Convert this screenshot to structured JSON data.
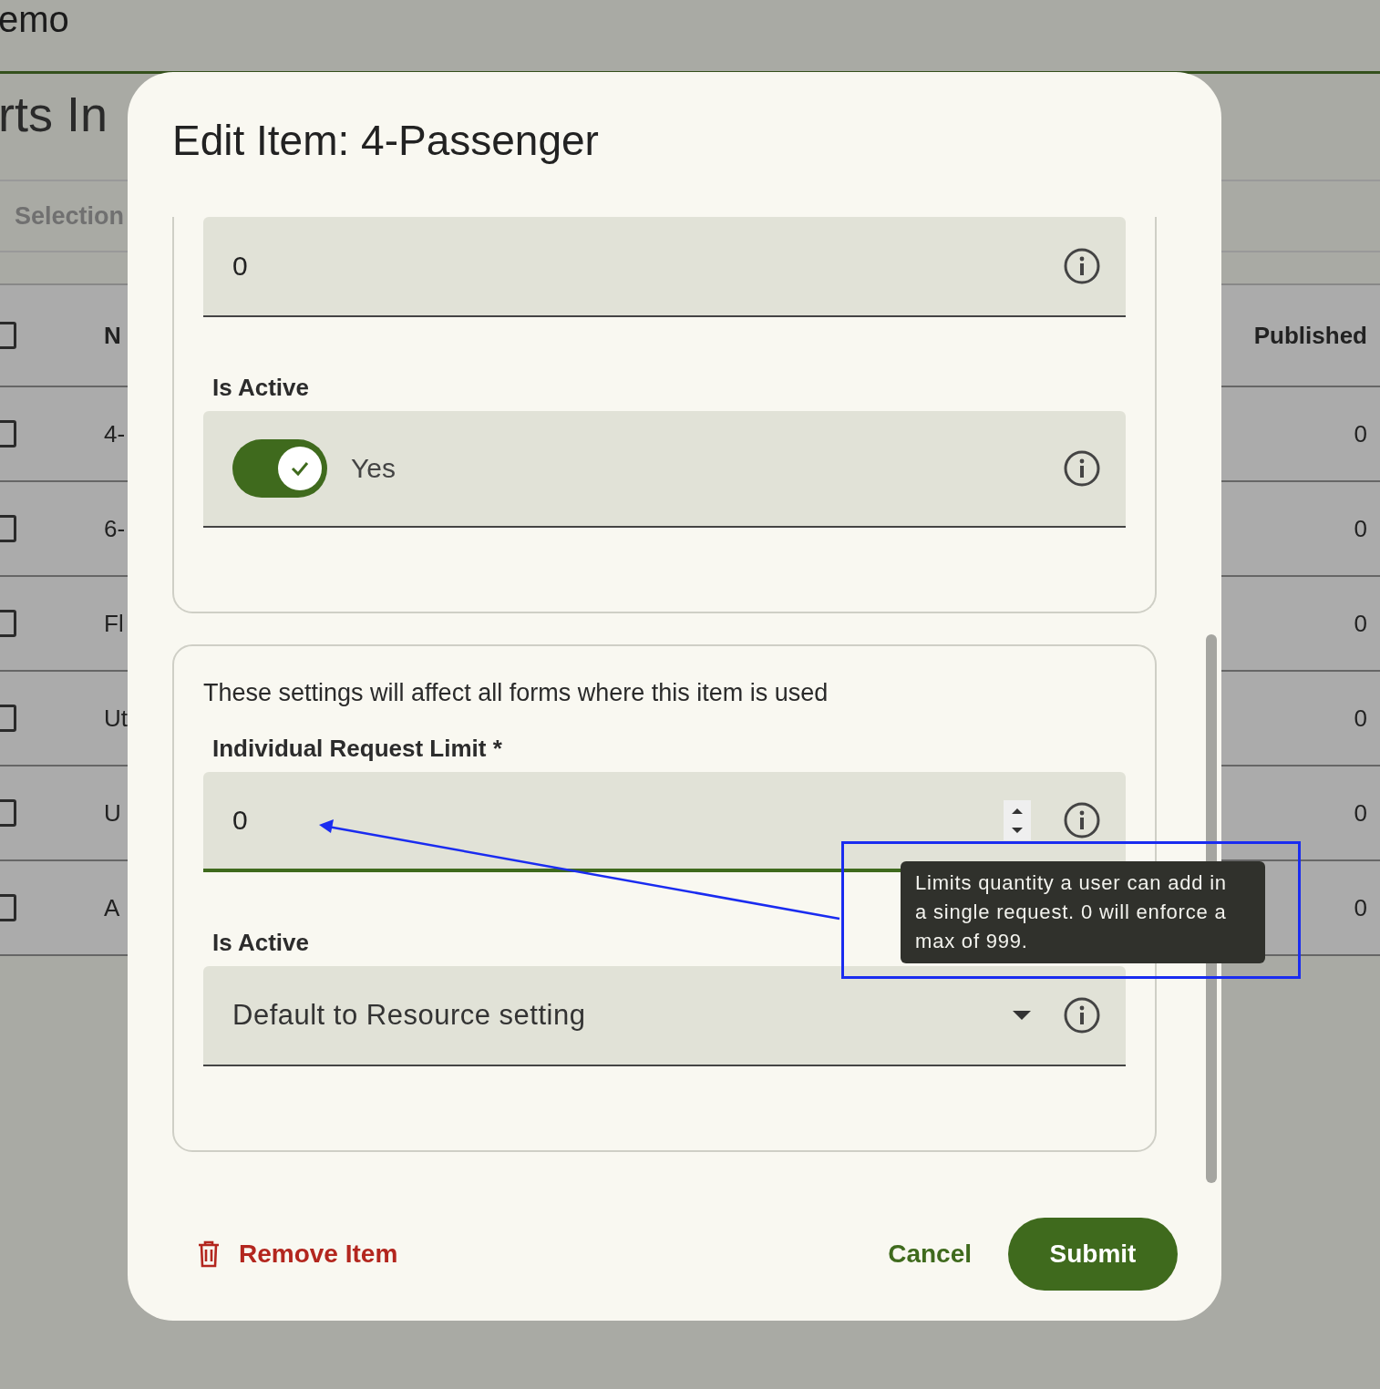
{
  "page": {
    "app_title": "emo",
    "heading": "rts In",
    "selection_tab": "Selection",
    "table": {
      "header_checked": false,
      "columns": [
        "N",
        "Published"
      ],
      "rows": [
        {
          "checked": false,
          "name": "4-",
          "published": "0"
        },
        {
          "checked": false,
          "name": "6-",
          "published": "0"
        },
        {
          "checked": false,
          "name": "Fl",
          "published": "0"
        },
        {
          "checked": false,
          "name": "Ut",
          "published": "0"
        },
        {
          "checked": false,
          "name": "U",
          "published": "0"
        },
        {
          "checked": false,
          "name": "A",
          "published": "0"
        }
      ]
    }
  },
  "dialog": {
    "title": "Edit Item: 4-Passenger",
    "sections": [
      {
        "fields": [
          {
            "kind": "number",
            "value": "0",
            "focused": false
          },
          {
            "kind": "toggle",
            "label": "Is Active",
            "on": true,
            "value": "Yes"
          }
        ]
      },
      {
        "description": "These settings will affect all forms where this item is used",
        "fields": [
          {
            "kind": "number",
            "label": "Individual Request Limit *",
            "value": "0",
            "focused": true,
            "tooltip": "Limits quantity a user can add in a single request. 0 will enforce a max of 999."
          },
          {
            "kind": "select",
            "label": "Is Active",
            "value": "Default to Resource setting"
          }
        ]
      }
    ],
    "actions": {
      "remove": "Remove Item",
      "cancel": "Cancel",
      "submit": "Submit"
    }
  }
}
